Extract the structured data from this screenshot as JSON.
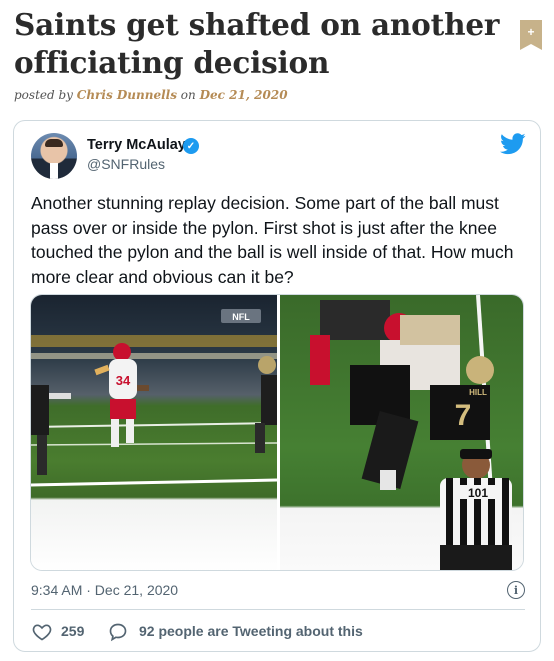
{
  "article": {
    "title": "Saints get shafted on another officiating decision",
    "posted_by_label": "posted by",
    "author": "Chris Dunnells",
    "on_label": "on",
    "date": "Dec 21, 2020"
  },
  "share_badge": "+",
  "tweet": {
    "display_name": "Terry McAulay",
    "handle": "@SNFRules",
    "text": "Another stunning replay decision. Some part of the ball must pass over or inside the pylon. First shot is just after the knee touched the pylon and the ball is well inside of that. How much more clear and obvious can it be?",
    "timestamp": "9:34 AM · Dec 21, 2020",
    "likes": "259",
    "replies_text": "92 people are Tweeting about this",
    "media": {
      "left_overlay": "NFL",
      "left_jersey": "34",
      "right_jersey": "7",
      "right_name": "HILL",
      "referee_number": "101"
    }
  },
  "icons": {
    "verified": "verified-badge",
    "twitter": "twitter-bird",
    "info": "info-circle",
    "like": "heart-outline",
    "reply": "speech-bubble"
  },
  "colors": {
    "accent": "#1d9bf0",
    "byline_accent": "#b58b55",
    "muted_text": "#536471"
  }
}
